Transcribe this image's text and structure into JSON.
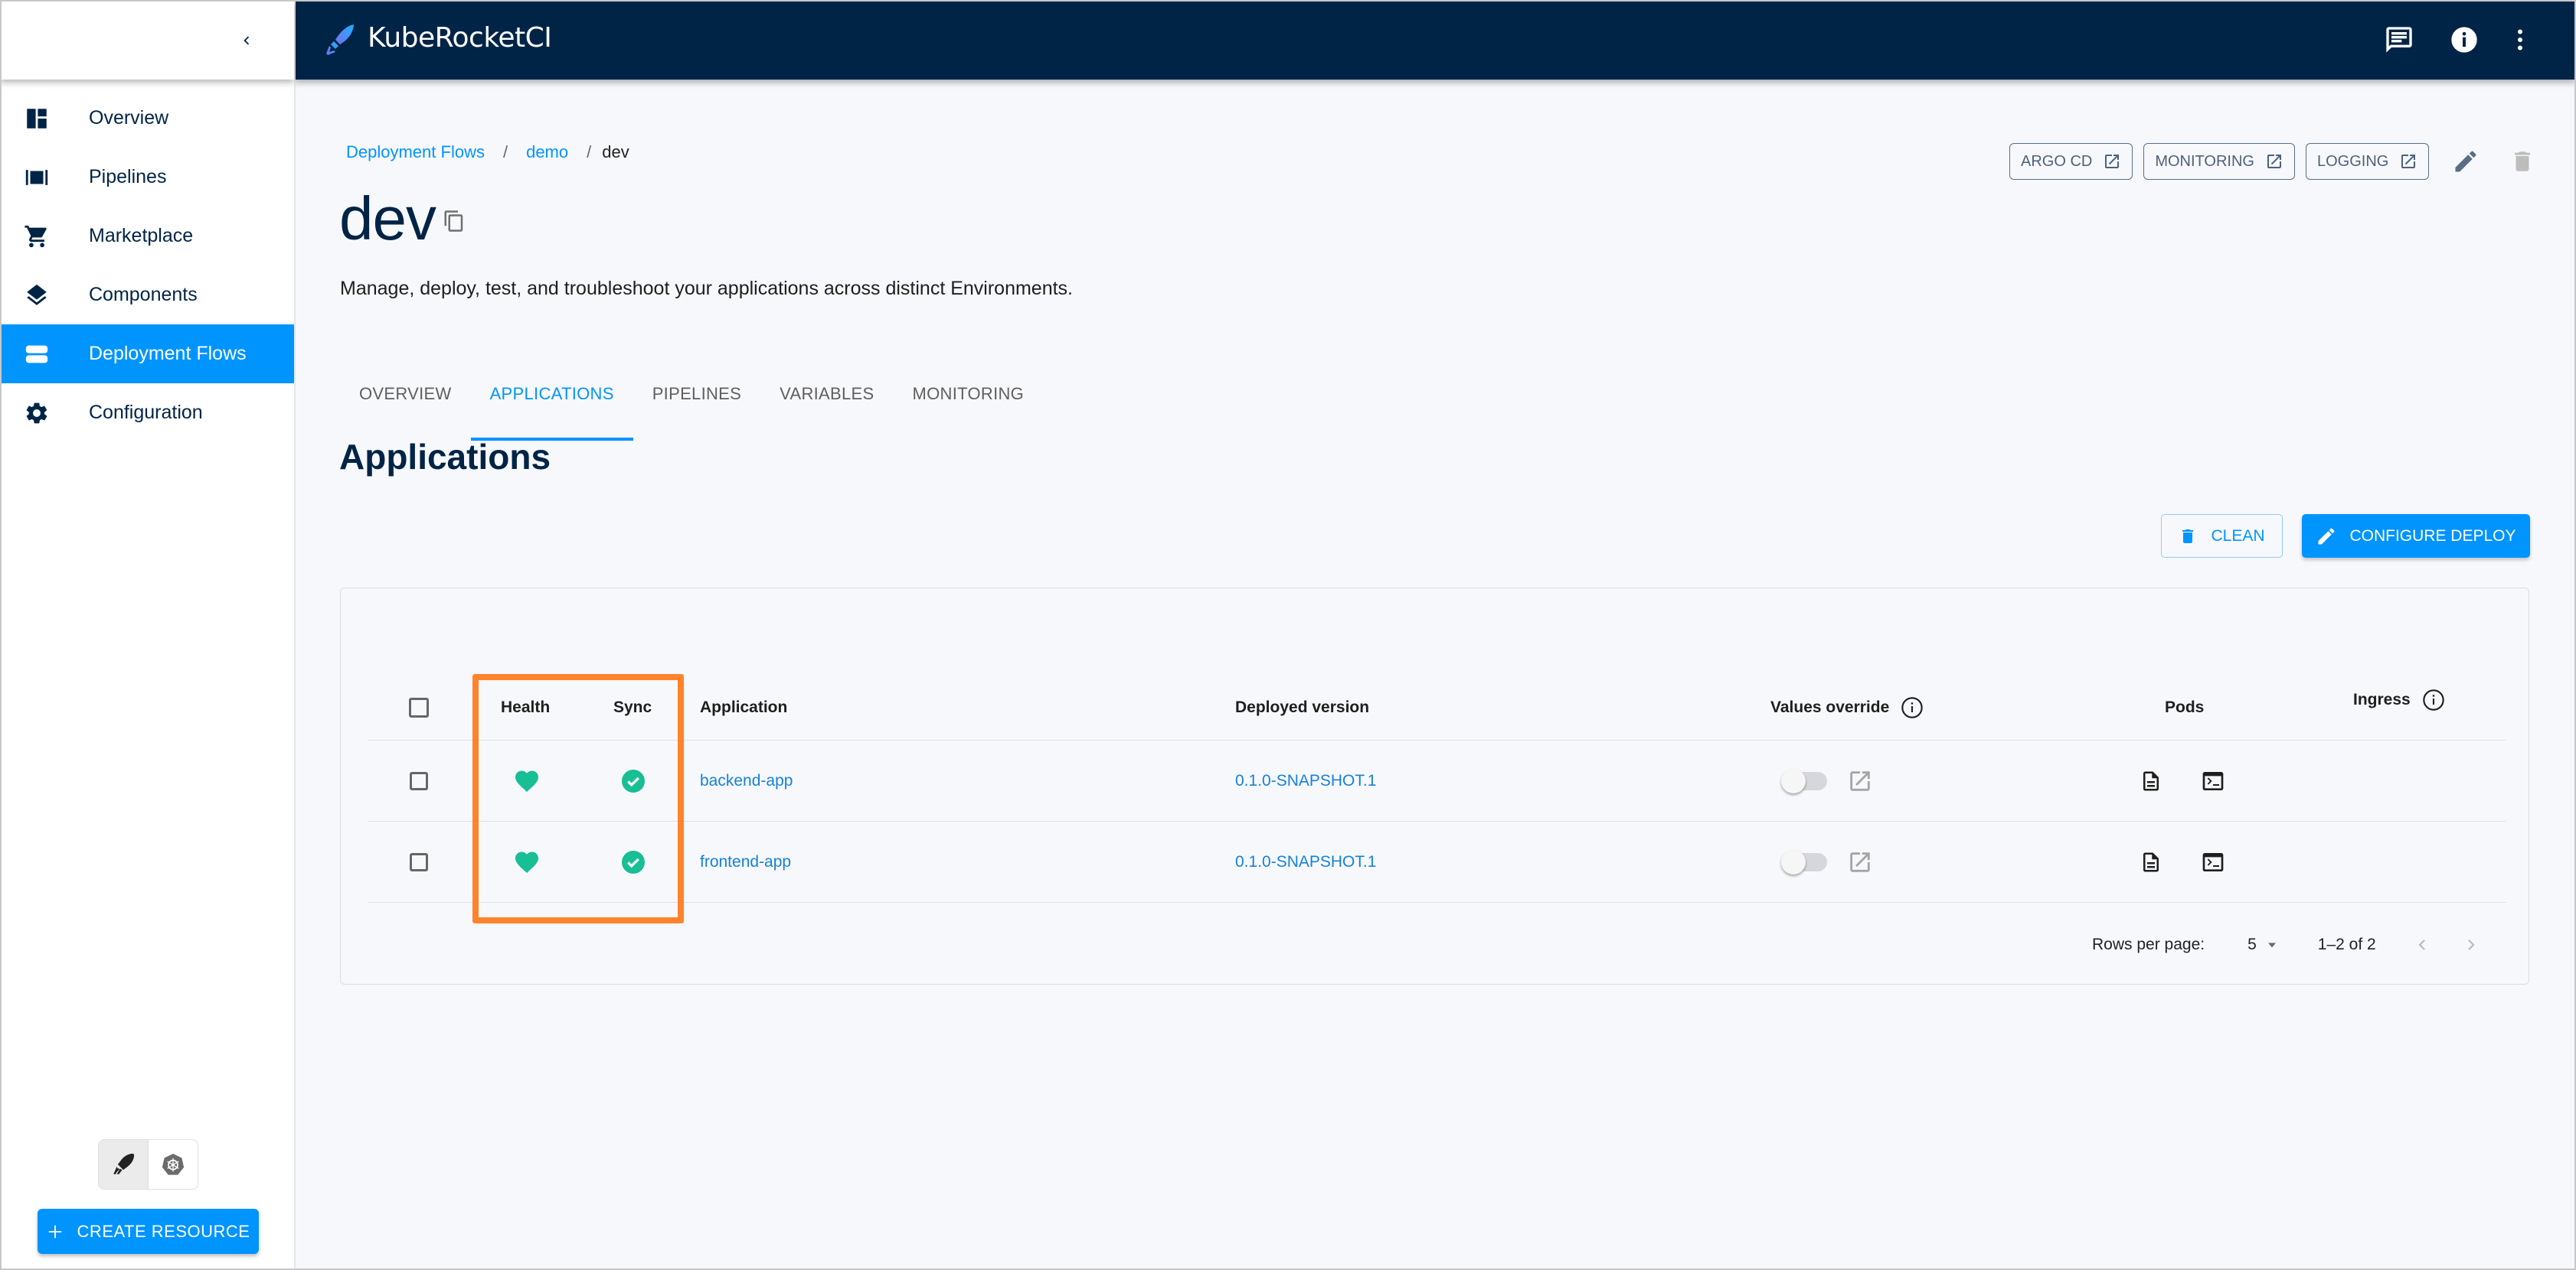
{
  "app": {
    "brand": "KubeRocketCI",
    "colors": {
      "primary": "#0094ff",
      "appbar": "#002446",
      "healthy": "#18be94",
      "highlight": "#ff832b"
    }
  },
  "sidebar": {
    "collapse_icon": "chevron-left-icon",
    "items": [
      {
        "label": "Overview",
        "icon": "dashboard-icon",
        "active": false
      },
      {
        "label": "Pipelines",
        "icon": "pipelines-icon",
        "active": false
      },
      {
        "label": "Marketplace",
        "icon": "cart-icon",
        "active": false
      },
      {
        "label": "Components",
        "icon": "layers-icon",
        "active": false
      },
      {
        "label": "Deployment Flows",
        "icon": "storage-icon",
        "active": true
      },
      {
        "label": "Configuration",
        "icon": "gear-icon",
        "active": false
      }
    ],
    "mode_toggle": [
      {
        "icon": "rocket-icon",
        "selected": true
      },
      {
        "icon": "kubernetes-icon",
        "selected": false
      }
    ],
    "create_resource_label": "CREATE RESOURCE"
  },
  "appbar": {
    "icons": [
      "feedback-icon",
      "info-icon",
      "more-vert-icon"
    ]
  },
  "breadcrumb": {
    "items": [
      {
        "label": "Deployment Flows",
        "link": true
      },
      {
        "label": "demo",
        "link": true
      },
      {
        "label": "dev",
        "link": false
      }
    ],
    "separator": "/"
  },
  "page": {
    "title": "dev",
    "description": "Manage, deploy, test, and troubleshoot your applications across distinct Environments.",
    "actions": [
      {
        "label": "ARGO CD",
        "icon": "open-in-new-icon"
      },
      {
        "label": "MONITORING",
        "icon": "open-in-new-icon"
      },
      {
        "label": "LOGGING",
        "icon": "open-in-new-icon"
      }
    ]
  },
  "tabs": [
    {
      "label": "OVERVIEW",
      "active": false
    },
    {
      "label": "APPLICATIONS",
      "active": true
    },
    {
      "label": "PIPELINES",
      "active": false
    },
    {
      "label": "VARIABLES",
      "active": false
    },
    {
      "label": "MONITORING",
      "active": false
    }
  ],
  "applications": {
    "title": "Applications",
    "clean_label": "CLEAN",
    "configure_label": "CONFIGURE DEPLOY",
    "columns": {
      "health": "Health",
      "sync": "Sync",
      "application": "Application",
      "deployed_version": "Deployed version",
      "values_override": "Values override",
      "pods": "Pods",
      "ingress": "Ingress"
    },
    "rows": [
      {
        "health": "Healthy",
        "sync": "Synced",
        "application": "backend-app",
        "deployed_version": "0.1.0-SNAPSHOT.1",
        "values_override": false
      },
      {
        "health": "Healthy",
        "sync": "Synced",
        "application": "frontend-app",
        "deployed_version": "0.1.0-SNAPSHOT.1",
        "values_override": false
      }
    ],
    "pagination": {
      "rows_per_page_label": "Rows per page:",
      "rows_per_page": "5",
      "range": "1–2 of 2"
    }
  }
}
